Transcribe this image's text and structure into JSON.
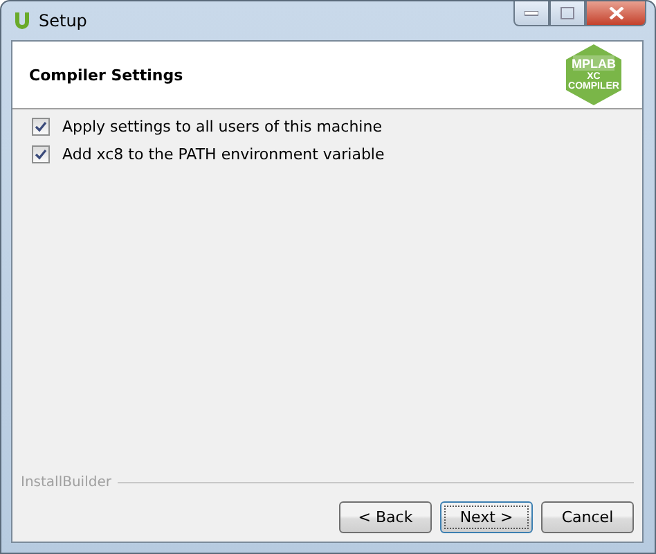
{
  "window": {
    "title": "Setup"
  },
  "header": {
    "title": "Compiler Settings",
    "logo": {
      "top": "MPLAB",
      "middle": "XC",
      "bottom": "COMPILER"
    }
  },
  "options": [
    {
      "label": "Apply settings to all users of this machine",
      "checked": true
    },
    {
      "label": "Add xc8 to the PATH environment variable",
      "checked": true
    }
  ],
  "footer": {
    "brand": "InstallBuilder"
  },
  "buttons": [
    {
      "label": "< Back",
      "selected": false
    },
    {
      "label": "Next >",
      "selected": true
    },
    {
      "label": "Cancel",
      "selected": false
    }
  ]
}
